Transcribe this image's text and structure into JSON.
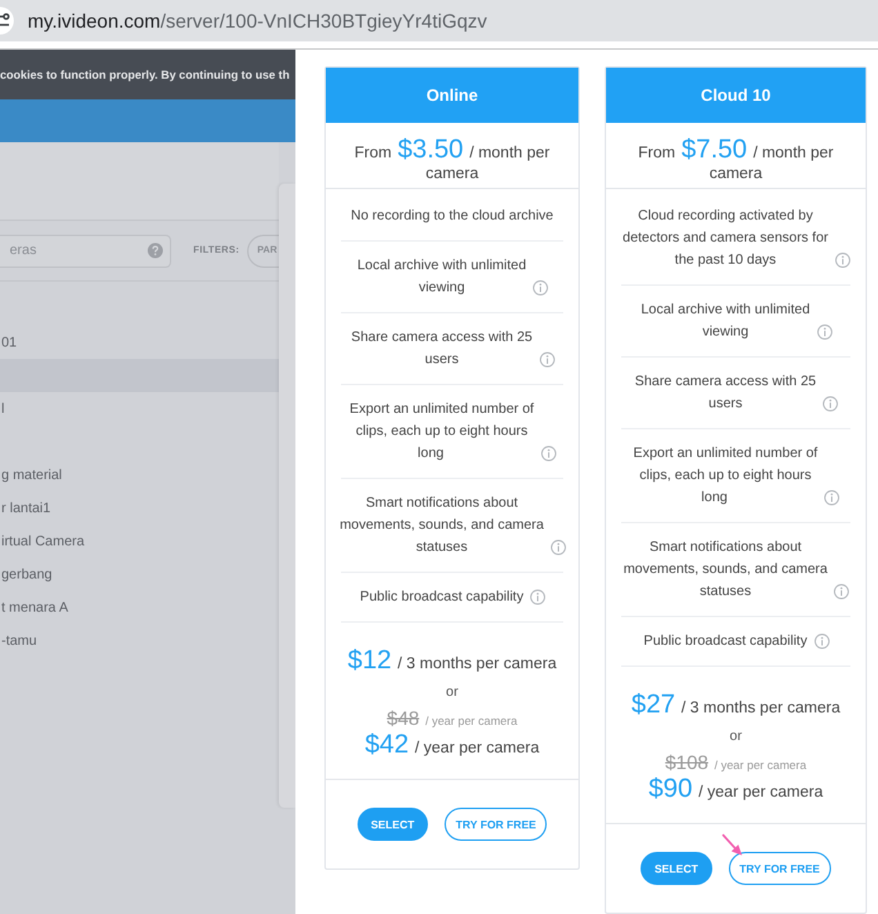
{
  "browser": {
    "url_host": "my.ivideon.com",
    "url_path": "/server/100-VnICH30BTgieyYr4tiGqzv"
  },
  "background_page": {
    "cookie_notice": "cookies to function properly. By continuing to use th",
    "search": {
      "placeholder": "eras"
    },
    "filters_label": "FILTERS:",
    "filter_chip": "PAR",
    "camera_groups": [
      {
        "rows": [
          {
            "name": "01",
            "selected": false
          },
          {
            "selected": true
          },
          {
            "name": "l",
            "selected": false
          }
        ]
      },
      {
        "rows": [
          {
            "name": "g material",
            "selected": false
          },
          {
            "name": "r lantai1",
            "selected": false
          },
          {
            "name": "irtual Camera",
            "selected": false
          },
          {
            "name": "gerbang",
            "selected": false
          },
          {
            "name": "t menara A",
            "selected": false
          },
          {
            "name": "-tamu",
            "selected": false
          }
        ]
      }
    ]
  },
  "plans": [
    {
      "title": "Online",
      "starting_price": {
        "label": "From",
        "amount": "$3.50",
        "unit": "/ month per camera"
      },
      "features": [
        {
          "text": "No recording to the cloud archive",
          "info": false
        },
        {
          "text": "Local archive with unlimited viewing",
          "info": true
        },
        {
          "text": "Share camera access with 25 users",
          "info": true
        },
        {
          "text": "Export an unlimited number of clips, each up to eight hours long",
          "info": true
        },
        {
          "text": "Smart notifications about movements, sounds, and camera statuses",
          "info": true
        },
        {
          "text": "Public broadcast capability",
          "info": true
        }
      ],
      "quarterly_price": {
        "amount": "$12",
        "unit": "/ 3 months per camera"
      },
      "or": "or",
      "old_yearly_price": {
        "amount": "$48",
        "unit": "/ year per camera",
        "struck": true
      },
      "yearly_price": {
        "amount": "$42",
        "unit": "/ year per camera"
      },
      "buttons": [
        {
          "label": "SELECT",
          "kind": "primary",
          "annotated": false
        },
        {
          "label": "TRY FOR FREE",
          "kind": "outline",
          "annotated": false
        }
      ]
    },
    {
      "title": "Cloud 10",
      "starting_price": {
        "label": "From",
        "amount": "$7.50",
        "unit": "/ month per camera"
      },
      "features": [
        {
          "text": "Cloud recording activated by detectors and camera sensors for the past 10 days",
          "info": true
        },
        {
          "text": "Local archive with unlimited viewing",
          "info": true
        },
        {
          "text": "Share camera access with 25 users",
          "info": true
        },
        {
          "text": "Export an unlimited number of clips, each up to eight hours long",
          "info": true
        },
        {
          "text": "Smart notifications about movements, sounds, and camera statuses",
          "info": true
        },
        {
          "text": "Public broadcast capability",
          "info": true
        }
      ],
      "quarterly_price": {
        "amount": "$27",
        "unit": "/ 3 months per camera"
      },
      "or": "or",
      "old_yearly_price": {
        "amount": "$108",
        "unit": "/ year per camera",
        "struck": true
      },
      "yearly_price": {
        "amount": "$90",
        "unit": "/ year per camera"
      },
      "buttons": [
        {
          "label": "SELECT",
          "kind": "primary",
          "annotated": false
        },
        {
          "label": "TRY FOR FREE",
          "kind": "outline",
          "annotated": true
        }
      ]
    }
  ]
}
